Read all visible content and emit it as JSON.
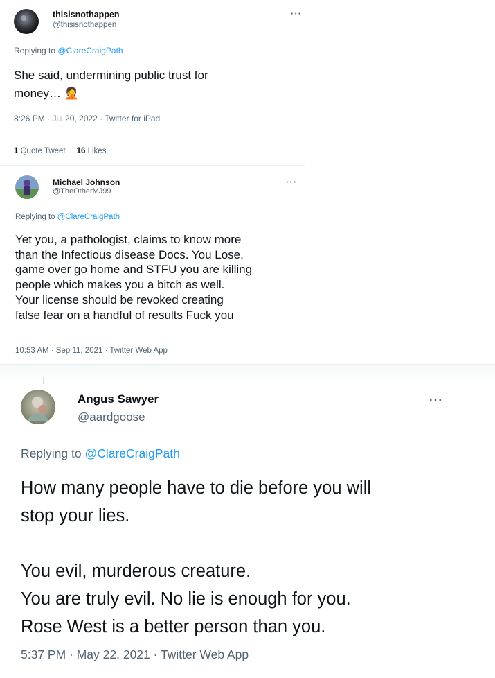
{
  "tweets": [
    {
      "author_name": "thisisnothappen",
      "author_handle": "@thisisnothappen",
      "more_icon": "more-horizontal-icon",
      "reply_prefix": "Replying to",
      "reply_handle": "@ClareCraigPath",
      "text_lines": [
        "She said, undermining public trust for",
        "money…"
      ],
      "emoji": "🤦",
      "meta": "8:26 PM · Jul 20, 2022 · Twitter for iPad",
      "stats": {
        "quote_count": "1",
        "quote_label": "Quote Tweet",
        "likes_count": "16",
        "likes_label": "Likes"
      }
    },
    {
      "author_name": "Michael Johnson",
      "author_handle": "@TheOtherMJ99",
      "more_icon": "more-horizontal-icon",
      "reply_prefix": "Replying to",
      "reply_handle": "@ClareCraigPath",
      "text_lines": [
        "Yet you, a pathologist, claims to know more",
        "than the Infectious disease Docs. You Lose,",
        "game over go home and STFU you are killing",
        "people which makes you a bitch as well.",
        "Your license should be revoked creating",
        "false fear on a handful of results Fuck you"
      ],
      "meta": "10:53 AM · Sep 11, 2021 · Twitter Web App"
    },
    {
      "author_name": "Angus Sawyer",
      "author_handle": "@aardgoose",
      "more_icon": "more-horizontal-icon",
      "reply_prefix": "Replying to",
      "reply_handle": "@ClareCraigPath",
      "text_lines": [
        "How many people have to die before you will",
        "stop your lies.",
        "",
        "You evil, murderous creature.",
        "You are truly evil. No lie is enough for you.",
        "Rose West is a better person than you."
      ],
      "meta": "5:37 PM · May 22, 2021 · Twitter Web App"
    }
  ]
}
